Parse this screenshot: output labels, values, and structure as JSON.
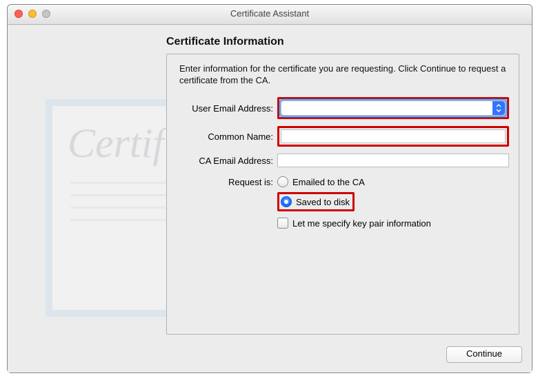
{
  "window": {
    "title": "Certificate Assistant"
  },
  "heading": "Certificate Information",
  "intro": "Enter information for the certificate you are requesting. Click Continue to request a certificate from the CA.",
  "form": {
    "user_email": {
      "label": "User Email Address:",
      "value": ""
    },
    "common_name": {
      "label": "Common Name:",
      "value": ""
    },
    "ca_email": {
      "label": "CA Email Address:",
      "value": ""
    },
    "request_is": {
      "label": "Request is:"
    },
    "option_emailed": "Emailed to the CA",
    "option_saved": "Saved to disk",
    "let_me_specify": "Let me specify key pair information"
  },
  "buttons": {
    "continue": "Continue"
  },
  "illustration": {
    "script_text": "Certificate"
  }
}
